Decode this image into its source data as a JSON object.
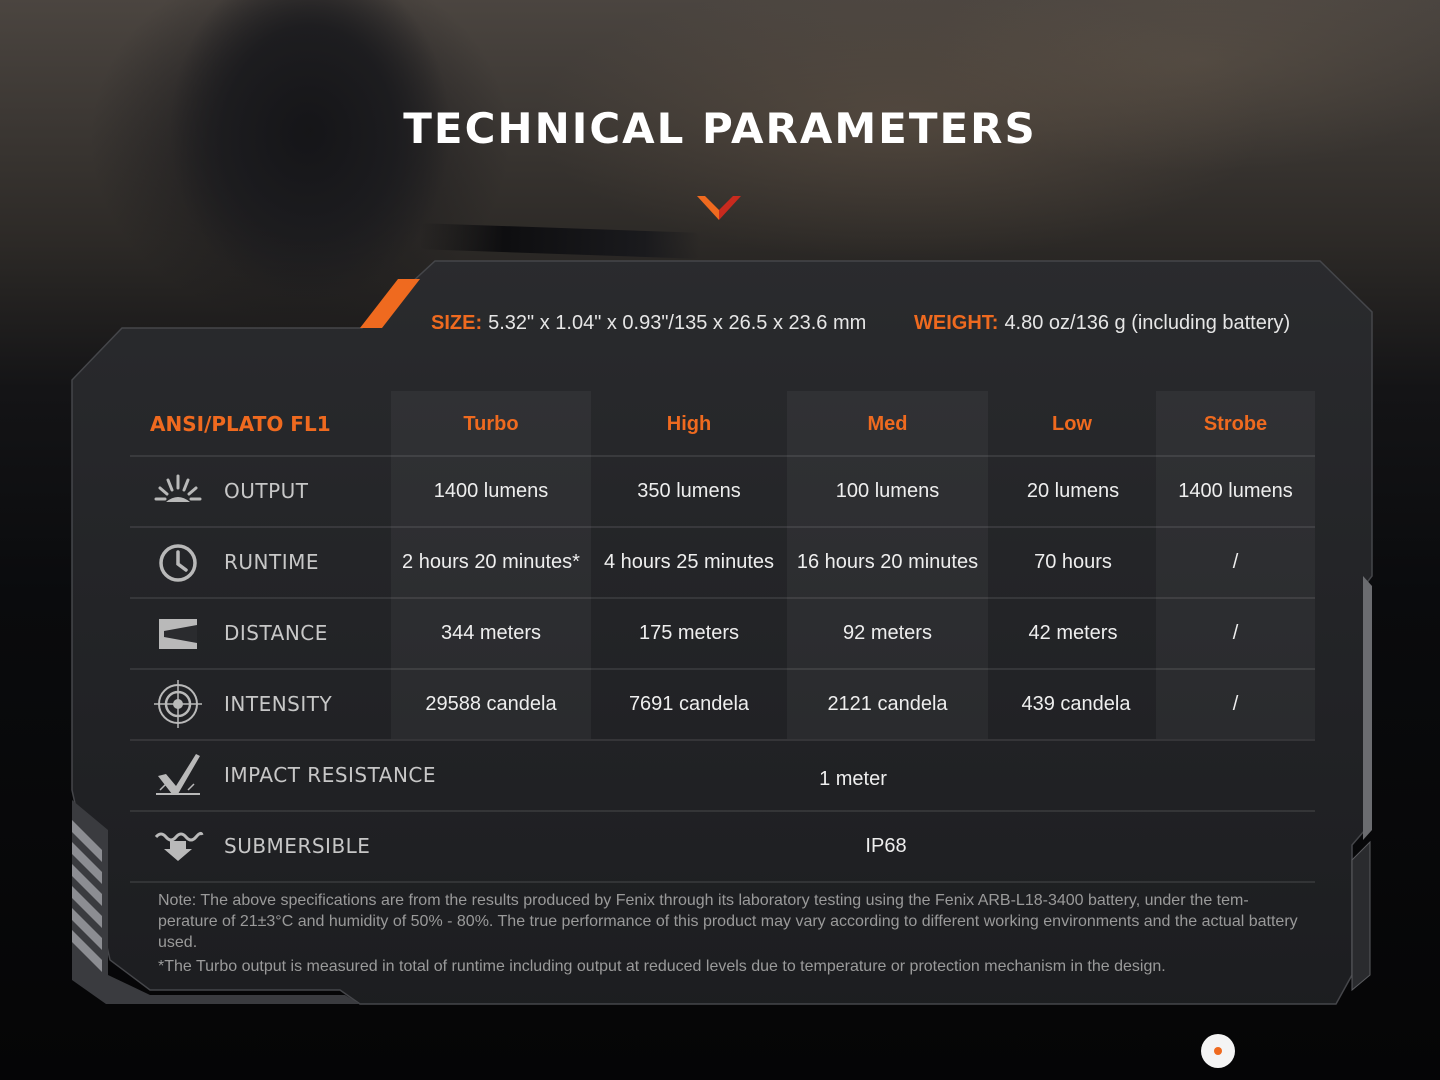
{
  "page": {
    "title": "TECHNICAL PARAMETERS"
  },
  "colors": {
    "accent": "#ef6a1f",
    "chevron_dark": "#c82a1e",
    "text": "#eeeeee",
    "muted": "#9a9a9a"
  },
  "specs": {
    "size_label": "SIZE:",
    "size_value": "5.32\" x 1.04\" x 0.93\"/135 x 26.5 x 23.6 mm",
    "weight_label": "WEIGHT:",
    "weight_value": "4.80 oz/136 g (including battery)"
  },
  "table": {
    "standard": "ANSI/PLATO FL1",
    "modes": [
      "Turbo",
      "High",
      "Med",
      "Low",
      "Strobe"
    ],
    "rows": [
      {
        "label": "OUTPUT",
        "icon": "light-burst-icon",
        "values": [
          "1400 lumens",
          "350 lumens",
          "100 lumens",
          "20 lumens",
          "1400 lumens"
        ]
      },
      {
        "label": "RUNTIME",
        "icon": "clock-icon",
        "values": [
          "2 hours 20 minutes*",
          "4 hours 25 minutes",
          "16 hours 20 minutes",
          "70 hours",
          "/"
        ]
      },
      {
        "label": "DISTANCE",
        "icon": "distance-icon",
        "values": [
          "344 meters",
          "175 meters",
          "92 meters",
          "42 meters",
          "/"
        ]
      },
      {
        "label": "INTENSITY",
        "icon": "target-icon",
        "values": [
          "29588 candela",
          "7691 candela",
          "2121 candela",
          "439 candela",
          "/"
        ]
      }
    ],
    "impact": {
      "label": "IMPACT RESISTANCE",
      "icon": "impact-check-icon",
      "value": "1 meter"
    },
    "submersible": {
      "label": "SUBMERSIBLE",
      "icon": "water-arrow-icon",
      "value": "IP68"
    }
  },
  "notes": {
    "main": "Note: The above specifications are from the results produced by Fenix through its laboratory testing using the Fenix ARB-L18-3400 battery, under the tem-perature of 21±3°C and humidity of 50% - 80%. The true performance of this product may vary according to different working environments and the actual battery used.",
    "turbo": "*The Turbo output is measured in total of runtime including output at reduced levels due to temperature or protection mechanism in the design."
  }
}
